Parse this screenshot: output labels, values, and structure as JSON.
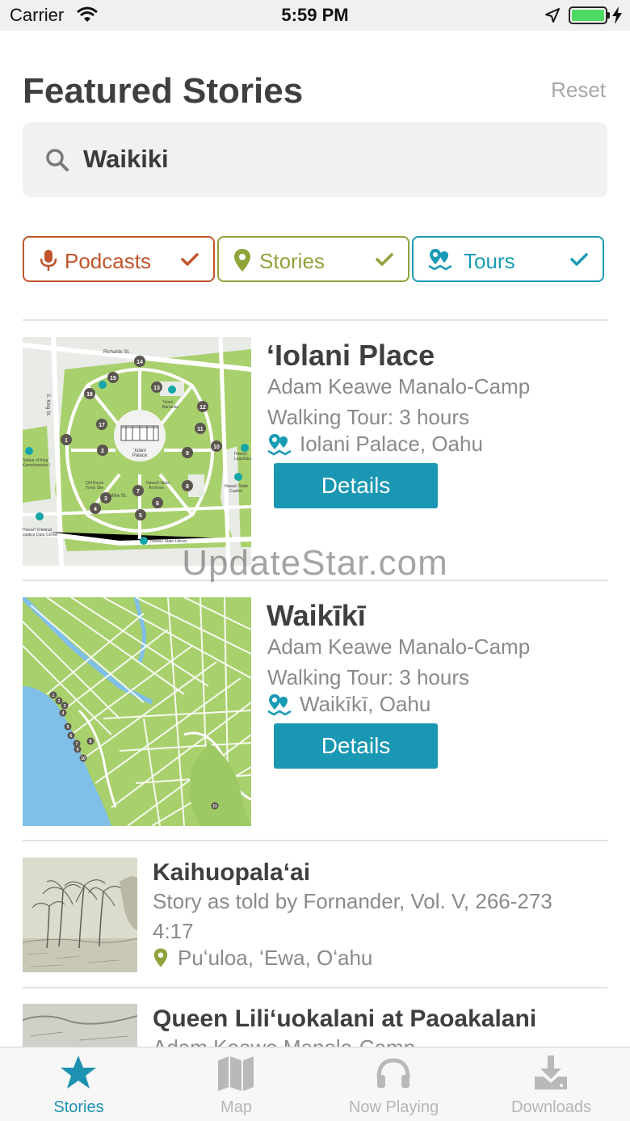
{
  "status_bar": {
    "carrier": "Carrier",
    "time": "5:59 PM"
  },
  "header": {
    "title": "Featured Stories",
    "reset_label": "Reset"
  },
  "search": {
    "value": "Waikiki"
  },
  "filters": [
    {
      "label": "Podcasts",
      "color": "#c0552c",
      "checked": true
    },
    {
      "label": "Stories",
      "color": "#8ea33a",
      "checked": true
    },
    {
      "label": "Tours",
      "color": "#1a9bb5",
      "checked": true
    }
  ],
  "tours": [
    {
      "title": "ʻIolani Place",
      "author": "Adam Keawe Manalo-Camp",
      "duration": "Walking Tour: 3 hours",
      "location": "Iolani Palace, Oahu",
      "button": "Details"
    },
    {
      "title": "Waikīkī",
      "author": "Adam Keawe Manalo-Camp",
      "duration": "Walking Tour: 3 hours",
      "location": "Waikīkī, Oahu",
      "button": "Details"
    }
  ],
  "map1_labels": [
    "Richards St.",
    "S. King St.",
    "ʻIolani Palace",
    "ʻIolani Barracks",
    "Old Royal Tomb Site",
    "Hawaiʻi State Archives",
    "Likelike St.",
    "Hawaiʻi State Library",
    "Hawaiʻi State Capitol",
    "Hawaiʻi Legislature",
    "Hawaiʻi Criminal Justice Data Center",
    "Statue of King Kamehameha I"
  ],
  "stories": [
    {
      "title": "Kaihuopalaʻai",
      "subtitle": "Story as told by Fornander, Vol. V, 266-273",
      "duration": "4:17",
      "location": "Puʻuloa, ʻEwa, Oʻahu"
    },
    {
      "title": "Queen Liliʻuokalani at Paoakalani",
      "subtitle": "Adam Keawe Manalo-Camp"
    }
  ],
  "watermark": "UpdateStar.com",
  "tabs": [
    {
      "label": "Stories",
      "icon": "star-icon",
      "active": true
    },
    {
      "label": "Map",
      "icon": "map-icon",
      "active": false
    },
    {
      "label": "Now Playing",
      "icon": "headphones-icon",
      "active": false
    },
    {
      "label": "Downloads",
      "icon": "download-icon",
      "active": false
    }
  ],
  "colors": {
    "accent": "#1a9bb5",
    "button": "#1997b3",
    "map_green": "#a6cf6b",
    "water": "#7fbfe8"
  }
}
